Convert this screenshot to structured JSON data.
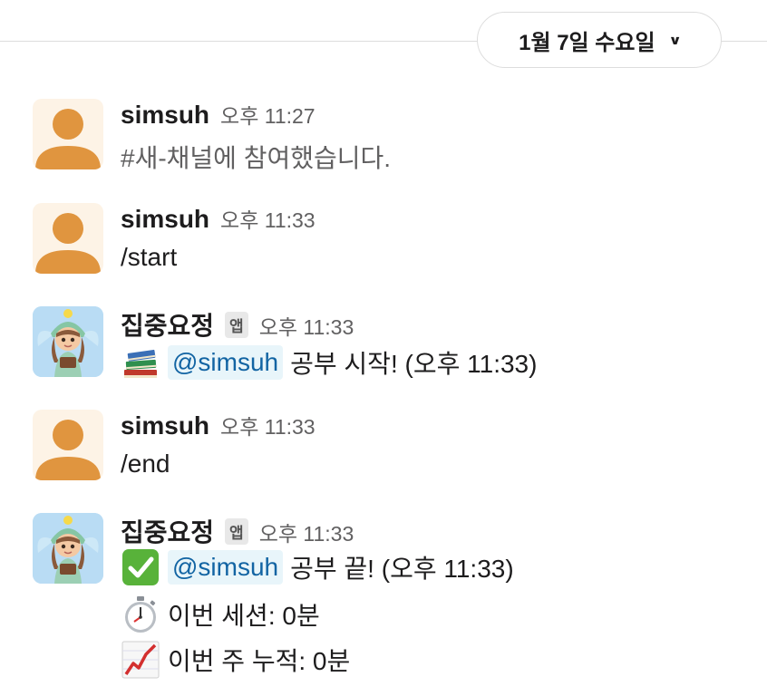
{
  "date_divider": {
    "label": "1월 7일 수요일",
    "chevron": "chevron-down-icon"
  },
  "messages": [
    {
      "author": "simsuh",
      "time": "오후 11:27",
      "text": "#새-채널에 참여했습니다."
    },
    {
      "author": "simsuh",
      "time": "오후 11:33",
      "text": "/start"
    },
    {
      "author": "집중요정",
      "badge": "앱",
      "time": "오후 11:33",
      "emoji": "books-icon",
      "mention": "@simsuh",
      "text": "공부 시작! (오후 11:33)"
    },
    {
      "author": "simsuh",
      "time": "오후 11:33",
      "text": "/end"
    },
    {
      "author": "집중요정",
      "badge": "앱",
      "time": "오후 11:33",
      "lines": [
        {
          "emoji": "check-mark-icon",
          "mention": "@simsuh",
          "text": "공부 끝! (오후 11:33)"
        },
        {
          "emoji": "stopwatch-icon",
          "text": "이번 세션: 0분"
        },
        {
          "emoji": "chart-increasing-icon",
          "text": "이번 주 누적: 0분"
        }
      ]
    }
  ],
  "colors": {
    "mention_bg": "#e8f5fa",
    "mention_text": "#1264a3",
    "check_green": "#58b23a",
    "user_avatar": "#e0953f"
  }
}
